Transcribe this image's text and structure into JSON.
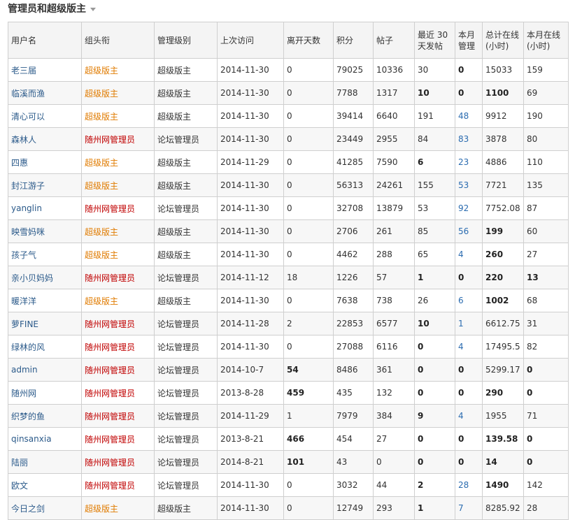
{
  "heading": "管理员和超级版主",
  "columns": [
    "用户名",
    "组头衔",
    "管理级别",
    "上次访问",
    "离开天数",
    "积分",
    "帖子",
    "最近 30 天发帖",
    "本月管理",
    "总计在线 (小时)",
    "本月在线 (小时)"
  ],
  "rows": [
    {
      "user": "老三届",
      "title": "超级版主",
      "level": "超级版主",
      "last": "2014-11-30",
      "away": "0",
      "points": "79025",
      "posts": "10336",
      "recent": "30",
      "manage": "0",
      "total": "15033",
      "month": "159"
    },
    {
      "user": "临溪而渔",
      "title": "超级版主",
      "level": "超级版主",
      "last": "2014-11-30",
      "away": "0",
      "points": "7788",
      "posts": "1317",
      "recent": "10",
      "manage": "0",
      "total": "1100",
      "month": "69"
    },
    {
      "user": "清心可以",
      "title": "超级版主",
      "level": "超级版主",
      "last": "2014-11-30",
      "away": "0",
      "points": "39414",
      "posts": "6640",
      "recent": "191",
      "manage": "48",
      "total": "9912",
      "month": "190"
    },
    {
      "user": "森林人",
      "title": "随州网管理员",
      "level": "论坛管理员",
      "last": "2014-11-30",
      "away": "0",
      "points": "23449",
      "posts": "2955",
      "recent": "84",
      "manage": "83",
      "total": "3878",
      "month": "80"
    },
    {
      "user": "四惠",
      "title": "超级版主",
      "level": "超级版主",
      "last": "2014-11-29",
      "away": "0",
      "points": "41285",
      "posts": "7590",
      "recent": "6",
      "manage": "23",
      "total": "4886",
      "month": "110"
    },
    {
      "user": "封江游子",
      "title": "超级版主",
      "level": "超级版主",
      "last": "2014-11-30",
      "away": "0",
      "points": "56313",
      "posts": "24261",
      "recent": "155",
      "manage": "53",
      "total": "7721",
      "month": "135"
    },
    {
      "user": "yanglin",
      "title": "随州网管理员",
      "level": "论坛管理员",
      "last": "2014-11-30",
      "away": "0",
      "points": "32708",
      "posts": "13879",
      "recent": "53",
      "manage": "92",
      "total": "7752.08",
      "month": "87"
    },
    {
      "user": "映雪妈咪",
      "title": "超级版主",
      "level": "超级版主",
      "last": "2014-11-30",
      "away": "0",
      "points": "2706",
      "posts": "261",
      "recent": "85",
      "manage": "56",
      "total": "199",
      "month": "60"
    },
    {
      "user": "孩子气",
      "title": "超级版主",
      "level": "超级版主",
      "last": "2014-11-30",
      "away": "0",
      "points": "4462",
      "posts": "288",
      "recent": "65",
      "manage": "4",
      "total": "260",
      "month": "27"
    },
    {
      "user": "亲小贝妈妈",
      "title": "随州网管理员",
      "level": "论坛管理员",
      "last": "2014-11-12",
      "away": "18",
      "points": "1226",
      "posts": "57",
      "recent": "1",
      "manage": "0",
      "total": "220",
      "month": "13"
    },
    {
      "user": "暖洋洋",
      "title": "超级版主",
      "level": "超级版主",
      "last": "2014-11-30",
      "away": "0",
      "points": "7638",
      "posts": "738",
      "recent": "26",
      "manage": "6",
      "total": "1002",
      "month": "68"
    },
    {
      "user": "萝FINE",
      "title": "随州网管理员",
      "level": "论坛管理员",
      "last": "2014-11-28",
      "away": "2",
      "points": "22853",
      "posts": "6577",
      "recent": "10",
      "manage": "1",
      "total": "6612.75",
      "month": "31"
    },
    {
      "user": "绿林的风",
      "title": "随州网管理员",
      "level": "论坛管理员",
      "last": "2014-11-30",
      "away": "0",
      "points": "27088",
      "posts": "6116",
      "recent": "0",
      "manage": "4",
      "total": "17495.5",
      "month": "82"
    },
    {
      "user": "admin",
      "title": "随州网管理员",
      "level": "论坛管理员",
      "last": "2014-10-7",
      "away": "54",
      "points": "8486",
      "posts": "361",
      "recent": "0",
      "manage": "0",
      "total": "5299.17",
      "month": "0"
    },
    {
      "user": "随州网",
      "title": "随州网管理员",
      "level": "论坛管理员",
      "last": "2013-8-28",
      "away": "459",
      "points": "435",
      "posts": "132",
      "recent": "0",
      "manage": "0",
      "total": "290",
      "month": "0"
    },
    {
      "user": "织梦的鱼",
      "title": "随州网管理员",
      "level": "论坛管理员",
      "last": "2014-11-29",
      "away": "1",
      "points": "7979",
      "posts": "384",
      "recent": "9",
      "manage": "4",
      "total": "1955",
      "month": "71"
    },
    {
      "user": "qinsanxia",
      "title": "随州网管理员",
      "level": "论坛管理员",
      "last": "2013-8-21",
      "away": "466",
      "points": "454",
      "posts": "27",
      "recent": "0",
      "manage": "0",
      "total": "139.58",
      "month": "0"
    },
    {
      "user": "陆丽",
      "title": "随州网管理员",
      "level": "论坛管理员",
      "last": "2014-8-21",
      "away": "101",
      "points": "43",
      "posts": "0",
      "recent": "0",
      "manage": "0",
      "total": "14",
      "month": "0"
    },
    {
      "user": "欧文",
      "title": "随州网管理员",
      "level": "论坛管理员",
      "last": "2014-11-30",
      "away": "0",
      "points": "3032",
      "posts": "44",
      "recent": "2",
      "manage": "28",
      "total": "1490",
      "month": "142"
    },
    {
      "user": "今日之剑",
      "title": "超级版主",
      "level": "超级版主",
      "last": "2014-11-30",
      "away": "0",
      "points": "12749",
      "posts": "293",
      "recent": "1",
      "manage": "7",
      "total": "8285.92",
      "month": "28"
    }
  ],
  "colors": {
    "super_moderator_title": "#e07b00",
    "admin_title": "#c00000",
    "username_link": "#2b5a8a",
    "manage_link": "#2b6cb0"
  }
}
